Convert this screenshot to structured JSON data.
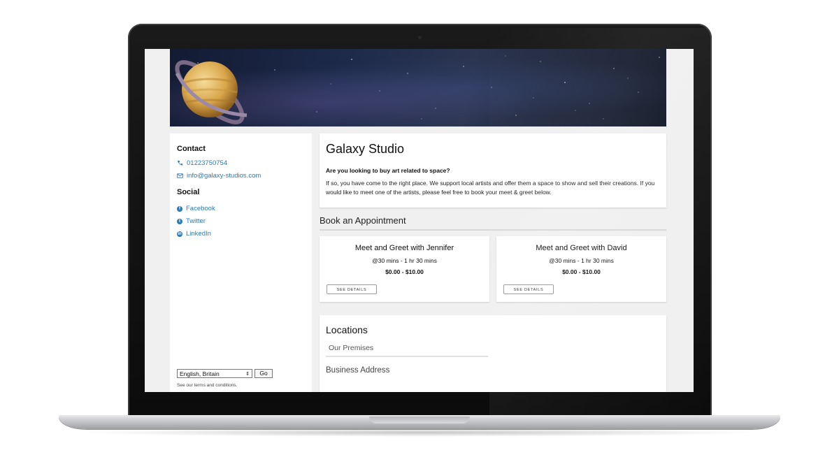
{
  "site": {
    "title": "Galaxy Studio",
    "intro_question": "Are you looking to buy art related to space?",
    "intro_paragraph": "If so, you have come to the right place. We support local artists and offer them a space to show and sell their creations. If you would like to meet one of the artists, please feel free to book your meet & greet below."
  },
  "sidebar": {
    "contact_heading": "Contact",
    "phone": "01223750754",
    "email": "info@galaxy-studios.com",
    "social_heading": "Social",
    "social_links": [
      "Facebook",
      "Twitter",
      "LinkedIn"
    ],
    "language_value": "English, Britain",
    "go_label": "Go",
    "terms": "See our terms and conditions."
  },
  "booking": {
    "heading": "Book an Appointment",
    "services": [
      {
        "name": "Meet and Greet with Jennifer",
        "duration": "30 mins - 1 hr 30 mins",
        "price": "$0.00 - $10.00",
        "details_label": "SEE DETAILS"
      },
      {
        "name": "Meet and Greet with David",
        "duration": "30 mins - 1 hr 30 mins",
        "price": "$0.00 - $10.00",
        "details_label": "SEE DETAILS"
      }
    ]
  },
  "locations": {
    "heading": "Locations",
    "tab": "Our Premises",
    "address_label": "Business Address"
  },
  "colors": {
    "link": "#2a7ab8",
    "page_bg": "#f0f0f0"
  },
  "icons": [
    "phone-icon",
    "mail-icon",
    "facebook-icon",
    "twitter-icon",
    "linkedin-icon",
    "clock-icon",
    "planet-logo"
  ]
}
